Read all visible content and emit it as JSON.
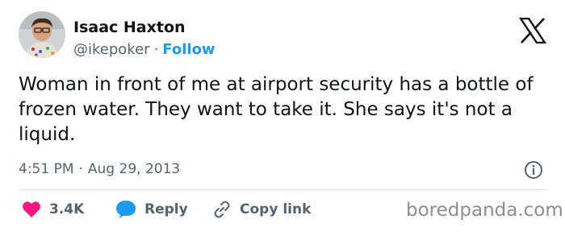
{
  "author": {
    "name": "Isaac Haxton",
    "handle": "@ikepoker",
    "separator": "·",
    "follow_label": "Follow"
  },
  "platform_icon": "x-logo-icon",
  "tweet": {
    "text": "Woman in front of me at airport security has a bottle of frozen water. They want to take it. She says it's not a liquid.",
    "time": "4:51 PM",
    "separator": "·",
    "date": "Aug 29, 2013"
  },
  "actions": {
    "likes_count": "3.4K",
    "reply_label": "Reply",
    "copy_link_label": "Copy link"
  },
  "icons": {
    "like": "heart-icon",
    "reply": "speech-bubble-icon",
    "copy": "link-icon",
    "info": "info-icon"
  },
  "colors": {
    "like": "#f91880",
    "reply": "#1d9bf0",
    "follow": "#1d9bf0",
    "secondary_text": "#536471"
  },
  "watermark": "boredpanda.com"
}
